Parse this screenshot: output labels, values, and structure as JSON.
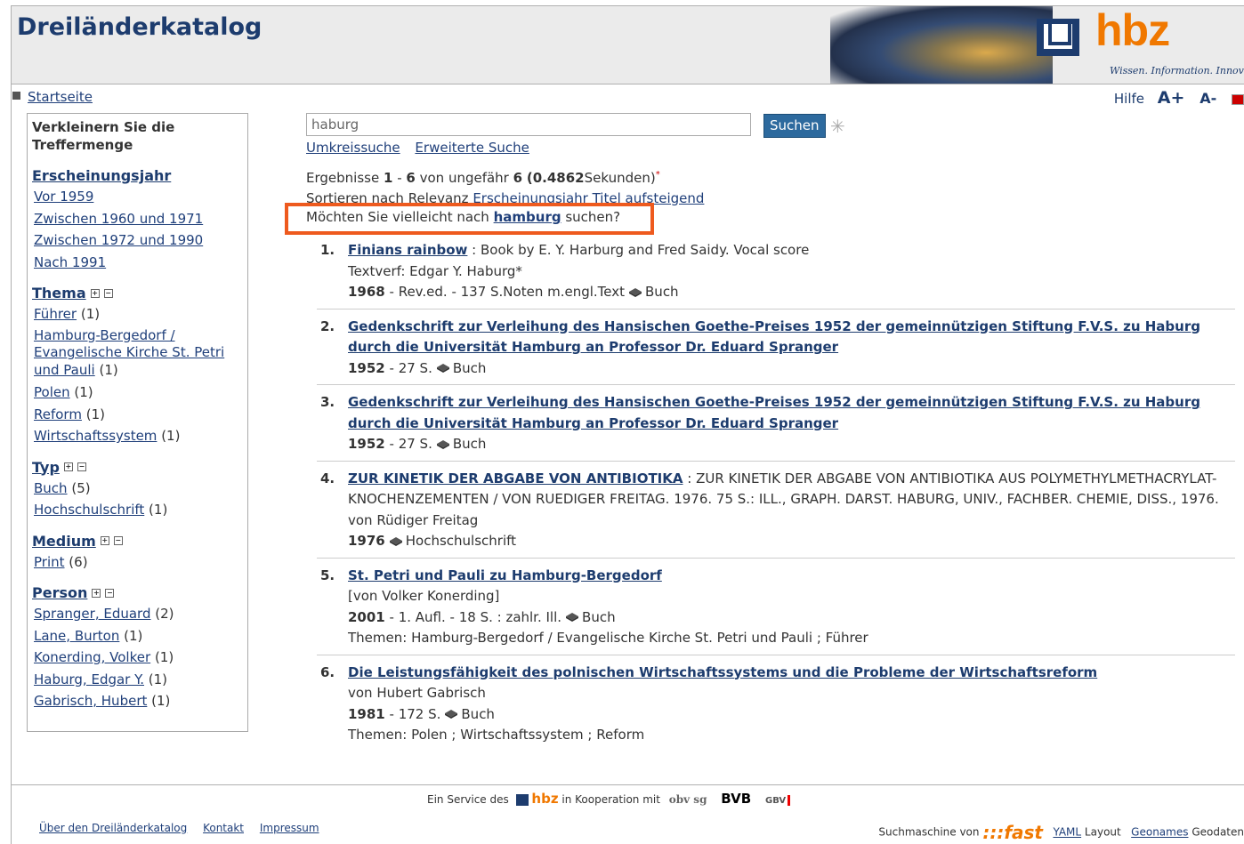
{
  "header": {
    "site_title": "Dreiländerkatalog",
    "logo_text": "hbz",
    "logo_tagline": "Wissen. Information. Innovation."
  },
  "nav": {
    "startseite": "Startseite",
    "hilfe": "Hilfe",
    "font_larger": "A+",
    "font_smaller": "A-"
  },
  "sidebar": {
    "header": "Verkleinern Sie die Treffermenge",
    "year": {
      "label": "Erscheinungsjahr",
      "items": [
        "Vor 1959",
        "Zwischen 1960 und 1971",
        "Zwischen 1972 und 1990",
        "Nach 1991"
      ]
    },
    "thema": {
      "label": "Thema",
      "items": [
        {
          "label": "Führer",
          "count": "(1)"
        },
        {
          "label": "Hamburg-Bergedorf / Evangelische Kirche St. Petri und Pauli",
          "count": "(1)"
        },
        {
          "label": "Polen",
          "count": "(1)"
        },
        {
          "label": "Reform",
          "count": "(1)"
        },
        {
          "label": "Wirtschaftssystem",
          "count": "(1)"
        }
      ]
    },
    "typ": {
      "label": "Typ",
      "items": [
        {
          "label": "Buch",
          "count": "(5)"
        },
        {
          "label": "Hochschulschrift",
          "count": "(1)"
        }
      ]
    },
    "medium": {
      "label": "Medium",
      "items": [
        {
          "label": "Print",
          "count": "(6)"
        }
      ]
    },
    "person": {
      "label": "Person",
      "items": [
        {
          "label": "Spranger, Eduard",
          "count": "(2)"
        },
        {
          "label": "Lane, Burton",
          "count": "(1)"
        },
        {
          "label": "Konerding, Volker",
          "count": "(1)"
        },
        {
          "label": "Haburg, Edgar Y.",
          "count": "(1)"
        },
        {
          "label": "Gabrisch, Hubert",
          "count": "(1)"
        }
      ]
    }
  },
  "search": {
    "value": "haburg",
    "button": "Suchen",
    "link_umkreis": "Umkreissuche",
    "link_erweitert": "Erweiterte Suche"
  },
  "results_info": {
    "prefix": "Ergebnisse",
    "from": "1",
    "dash": "-",
    "to": "6",
    "middle": "von ungefähr",
    "total": "6",
    "time": "(0.4862",
    "suffix": "Sekunden)",
    "asterisk": "*"
  },
  "sort": {
    "prefix": "Sortieren nach",
    "relevanz": "Relevanz",
    "jahr": "Erscheinungsjahr",
    "titel": "Titel",
    "asc": "aufsteigend"
  },
  "suggest": {
    "prefix": "Möchten Sie vielleicht nach",
    "term": "hamburg",
    "suffix": "suchen?"
  },
  "results": [
    {
      "num": "1.",
      "title": "Finians rainbow",
      "line1_rest": " : Book by E. Y. Harburg and Fred Saidy. Vocal score",
      "line2": "Textverf: Edgar Y. Haburg*",
      "year": "1968",
      "details": " - Rev.ed. - 137 S.Noten m.engl.Text",
      "type": "Buch"
    },
    {
      "num": "2.",
      "title": "Gedenkschrift zur Verleihung des Hansischen Goethe-Preises 1952 der gemeinnützigen Stiftung F.V.S. zu Haburg durch die Universität Hamburg an Professor Dr. Eduard Spranger",
      "year": "1952",
      "details": " - 27 S.",
      "type": "Buch"
    },
    {
      "num": "3.",
      "title": "Gedenkschrift zur Verleihung des Hansischen Goethe-Preises 1952 der gemeinnützigen Stiftung F.V.S. zu Haburg durch die Universität Hamburg an Professor Dr. Eduard Spranger",
      "year": "1952",
      "details": " - 27 S.",
      "type": "Buch"
    },
    {
      "num": "4.",
      "title": "ZUR KINETIK DER ABGABE VON ANTIBIOTIKA",
      "line1_rest": " : ZUR KINETIK DER ABGABE VON ANTIBIOTIKA AUS POLYMETHYLMETHACRYLAT-KNOCHENZEMENTEN / VON RUEDIGER FREITAG. 1976. 75 S.: ILL., GRAPH. DARST. HABURG, UNIV., FACHBER. CHEMIE, DISS., 1976.",
      "line2": "von Rüdiger Freitag",
      "year": "1976",
      "type": "Hochschulschrift"
    },
    {
      "num": "5.",
      "title": "St. Petri und Pauli zu Hamburg-Bergedorf",
      "line2": "[von Volker Konerding]",
      "year": "2001",
      "details": " - 1. Aufl. - 18 S. : zahlr. Ill.",
      "type": "Buch",
      "themen": "Themen: Hamburg-Bergedorf / Evangelische Kirche St. Petri und Pauli ; Führer"
    },
    {
      "num": "6.",
      "title": "Die Leistungsfähigkeit des polnischen Wirtschaftssystems und die Probleme der Wirtschaftsreform",
      "line2": "von Hubert Gabrisch",
      "year": "1981",
      "details": " - 172 S.",
      "type": "Buch",
      "themen": "Themen: Polen ; Wirtschaftssystem ; Reform"
    }
  ],
  "footer": {
    "service_prefix": "Ein Service des",
    "hbz": "hbz",
    "koop": "in Kooperation mit",
    "obvsg": "obv sg",
    "bvb": "BVB",
    "gbv": "GBV",
    "links": [
      "Über den Dreiländerkatalog",
      "Kontakt",
      "Impressum"
    ],
    "suchmaschine": "Suchmaschine von",
    "fast": ":::fast",
    "yaml": "YAML",
    "layout": "Layout",
    "geonames": "Geonames",
    "geodaten": "Geodaten"
  }
}
